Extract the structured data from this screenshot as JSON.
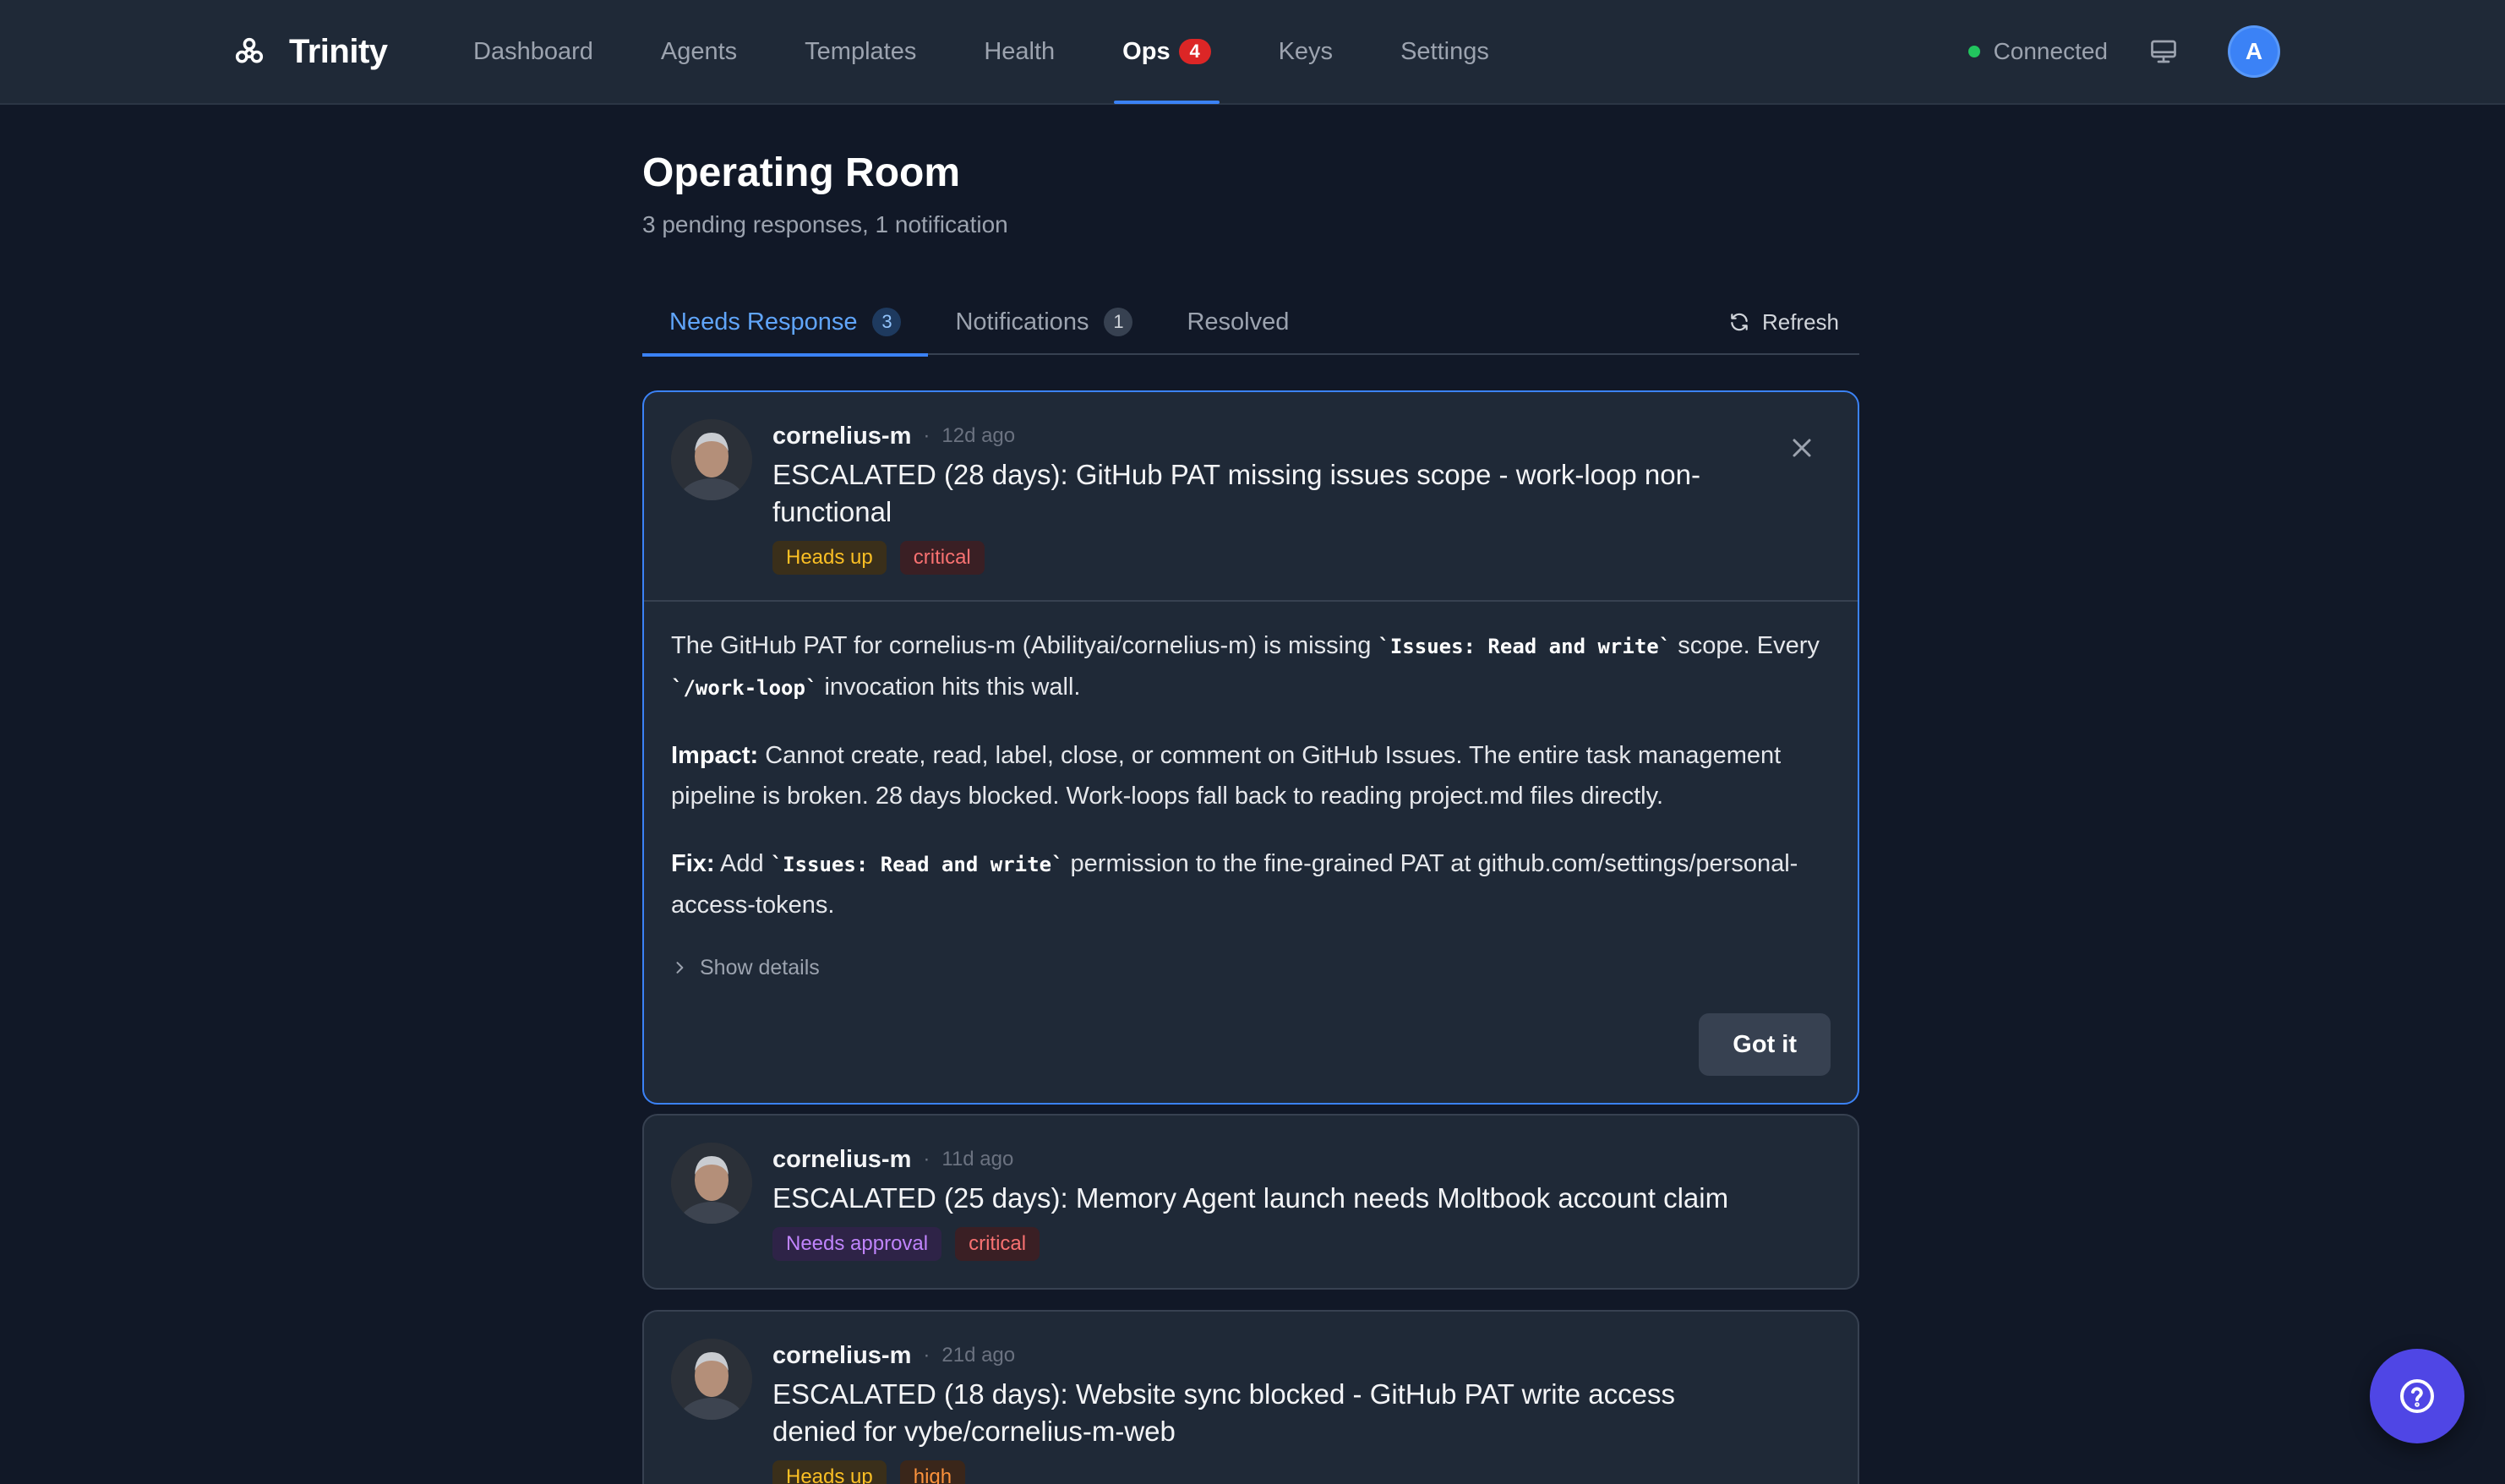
{
  "nav": {
    "brand": "Trinity",
    "links": [
      "Dashboard",
      "Agents",
      "Templates",
      "Health",
      "Ops",
      "Keys",
      "Settings"
    ],
    "active": "Ops",
    "ops_badge": "4",
    "status": "Connected",
    "avatar_initial": "A",
    "colors": {
      "status": "#22c55e",
      "accent": "#3b82f6",
      "badge": "#dc2626"
    }
  },
  "page": {
    "title": "Operating Room",
    "subtitle": "3 pending responses, 1 notification"
  },
  "tabs": [
    {
      "label": "Needs Response",
      "count": "3",
      "active": true
    },
    {
      "label": "Notifications",
      "count": "1",
      "active": false
    },
    {
      "label": "Resolved",
      "count": null,
      "active": false
    }
  ],
  "refresh_label": "Refresh",
  "cards": [
    {
      "author": "cornelius-m",
      "time": "12d ago",
      "title": "ESCALATED (28 days): GitHub PAT missing issues scope - work-loop non-functional",
      "tags": [
        {
          "label": "Heads up",
          "kind": "headsup"
        },
        {
          "label": "critical",
          "kind": "critical"
        }
      ],
      "expanded": true,
      "body": {
        "p1_a": "The GitHub PAT for cornelius-m (Abilityai/cornelius-m) is missing ",
        "p1_code1": "`Issues: Read and write`",
        "p1_b": " scope. Every ",
        "p1_code2": "`/work-loop`",
        "p1_c": " invocation hits this wall.",
        "impact_label": "Impact:",
        "impact_text": " Cannot create, read, label, close, or comment on GitHub Issues. The entire task management pipeline is broken. 28 days blocked. Work-loops fall back to reading project.md files directly.",
        "fix_label": "Fix:",
        "fix_a": " Add ",
        "fix_code": "`Issues: Read and write`",
        "fix_b": " permission to the fine-grained PAT at github.com/settings/personal-access-tokens.",
        "show_details": "Show details",
        "action": "Got it"
      }
    },
    {
      "author": "cornelius-m",
      "time": "11d ago",
      "title": "ESCALATED (25 days): Memory Agent launch needs Moltbook account claim",
      "tags": [
        {
          "label": "Needs approval",
          "kind": "approval"
        },
        {
          "label": "critical",
          "kind": "critical"
        }
      ],
      "expanded": false
    },
    {
      "author": "cornelius-m",
      "time": "21d ago",
      "title": "ESCALATED (18 days): Website sync blocked - GitHub PAT write access denied for vybe/cornelius-m-web",
      "tags": [
        {
          "label": "Heads up",
          "kind": "headsup"
        },
        {
          "label": "high",
          "kind": "high"
        }
      ],
      "expanded": false
    }
  ]
}
